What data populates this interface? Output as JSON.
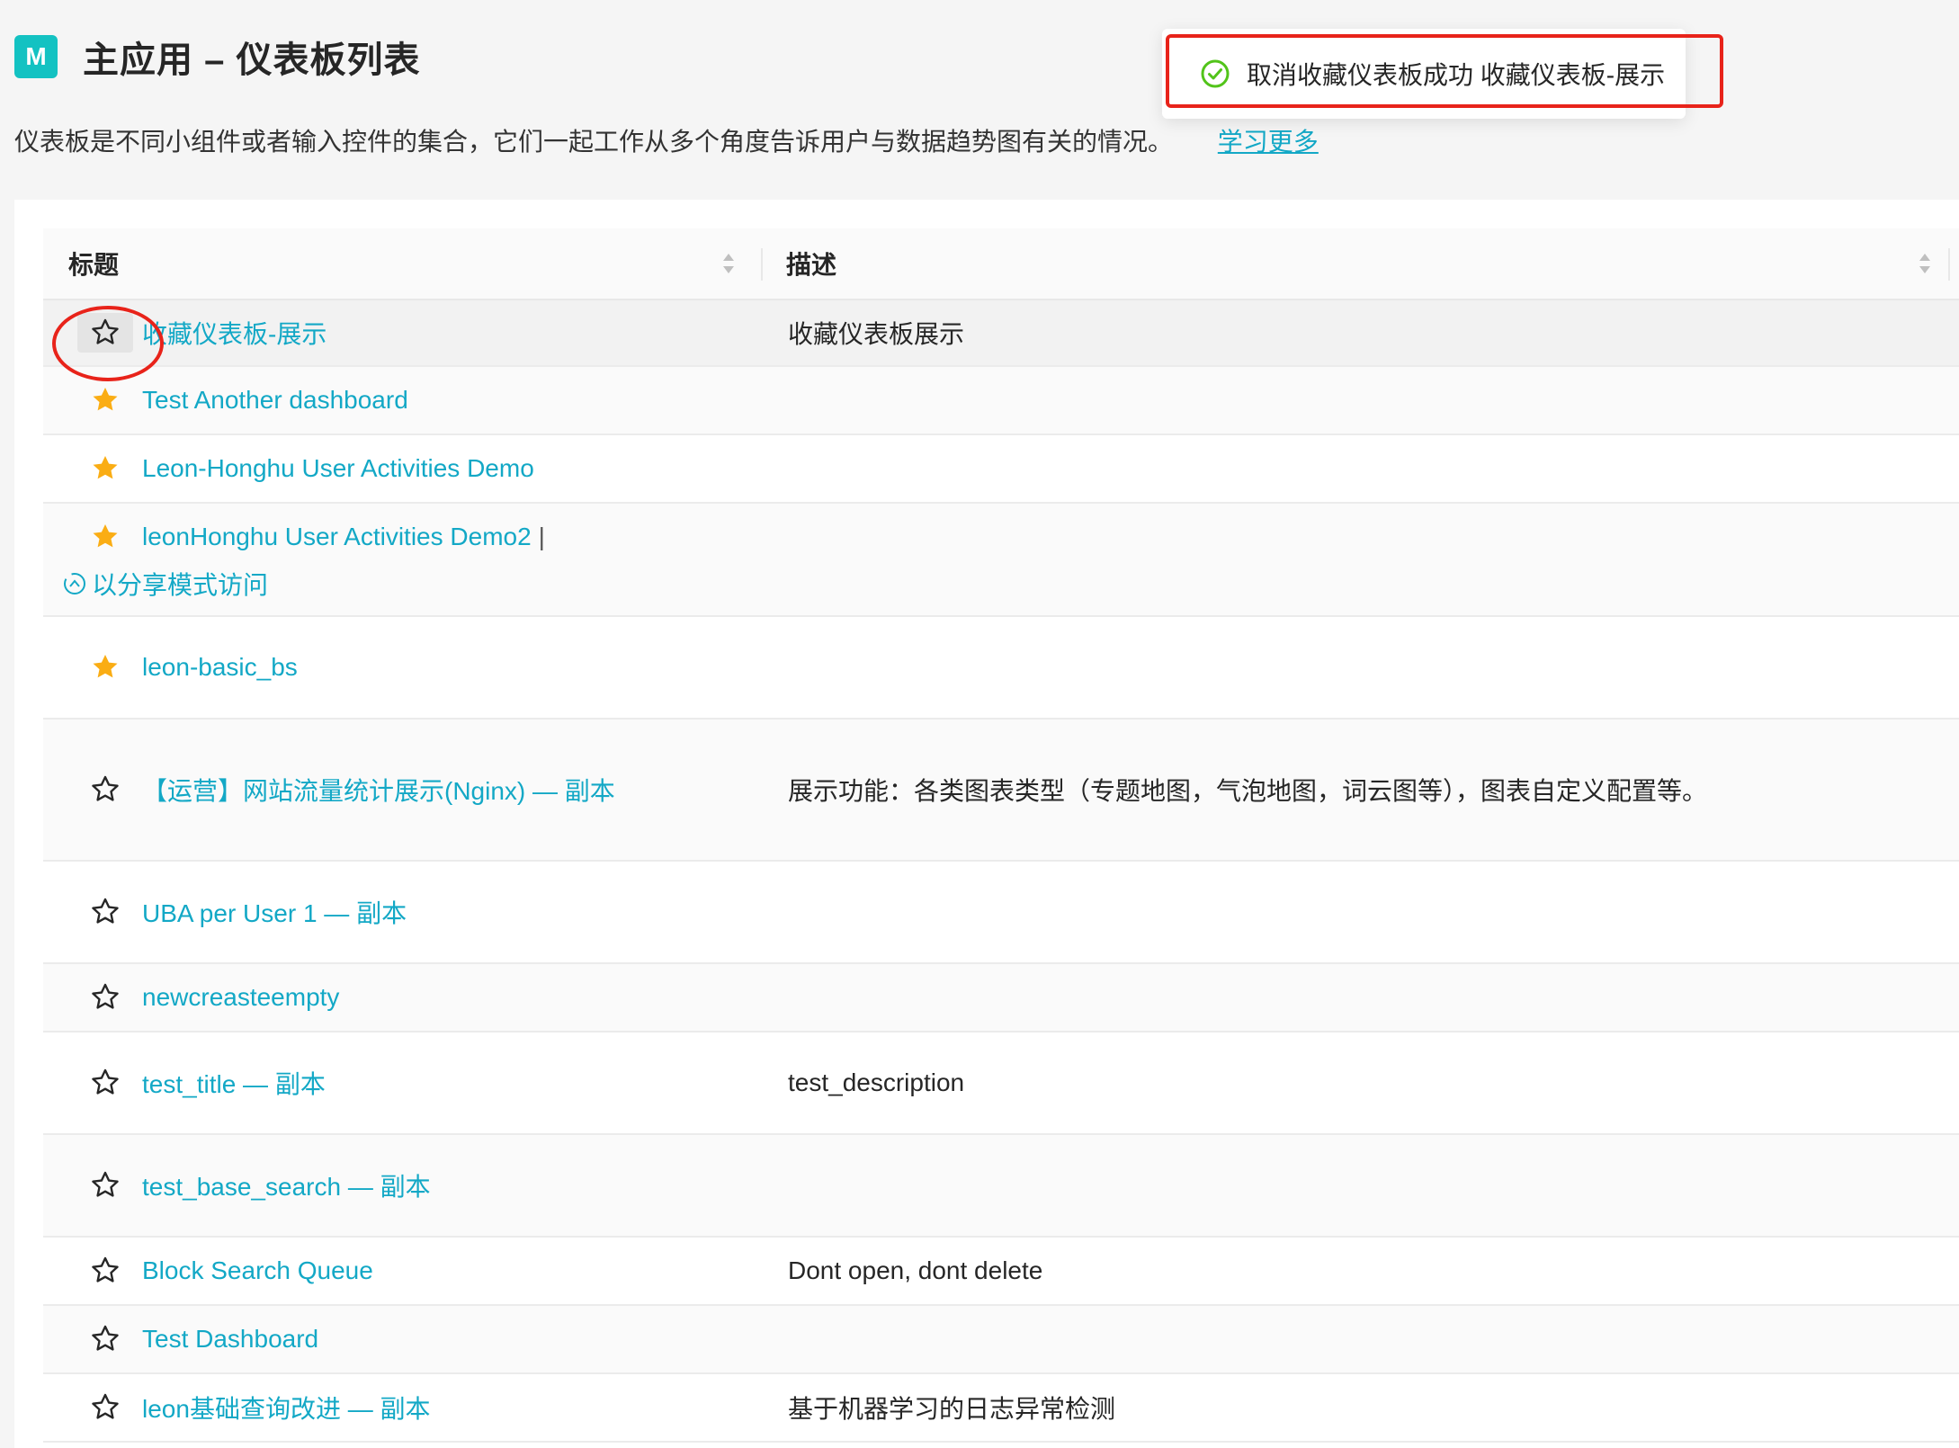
{
  "header": {
    "app_icon_letter": "M",
    "title": "主应用 – 仪表板列表"
  },
  "description": {
    "text": "仪表板是不同小组件或者输入控件的集合，它们一起工作从多个角度告诉用户与数据趋势图有关的情况。",
    "learn_more": "学习更多"
  },
  "toast": {
    "icon": "check-circle-icon",
    "message": "取消收藏仪表板成功 收藏仪表板-展示"
  },
  "table": {
    "columns": {
      "title": "标题",
      "description": "描述"
    },
    "rows": [
      {
        "title": "收藏仪表板-展示",
        "description": "收藏仪表板展示",
        "favorite": false
      },
      {
        "title": "Test Another dashboard",
        "description": "",
        "favorite": true
      },
      {
        "title": "Leon-Honghu User Activities Demo",
        "description": "",
        "favorite": true
      },
      {
        "title": "leonHonghu User Activities Demo2",
        "description": "",
        "favorite": true,
        "separator": "|",
        "share_link": "以分享模式访问"
      },
      {
        "title": "leon-basic_bs",
        "description": "",
        "favorite": true
      },
      {
        "title": "【运营】网站流量统计展示(Nginx) — 副本",
        "description": "展示功能：各类图表类型（专题地图，气泡地图，词云图等），图表自定义配置等。",
        "favorite": false
      },
      {
        "title": "UBA per User 1 — 副本",
        "description": "",
        "favorite": false
      },
      {
        "title": "newcreasteempty",
        "description": "",
        "favorite": false
      },
      {
        "title": "test_title — 副本",
        "description": "test_description",
        "favorite": false
      },
      {
        "title": "test_base_search — 副本",
        "description": "",
        "favorite": false
      },
      {
        "title": "Block Search Queue",
        "description": "Dont open, dont delete",
        "favorite": false
      },
      {
        "title": "Test Dashboard",
        "description": "",
        "favorite": false
      },
      {
        "title": "leon基础查询改进 — 副本",
        "description": "基于机器学习的日志异常检测",
        "favorite": false
      }
    ]
  },
  "colors": {
    "accent": "#13a8c6",
    "favorite_star": "#faad14",
    "success": "#52c41a",
    "highlight": "#e8231a"
  }
}
